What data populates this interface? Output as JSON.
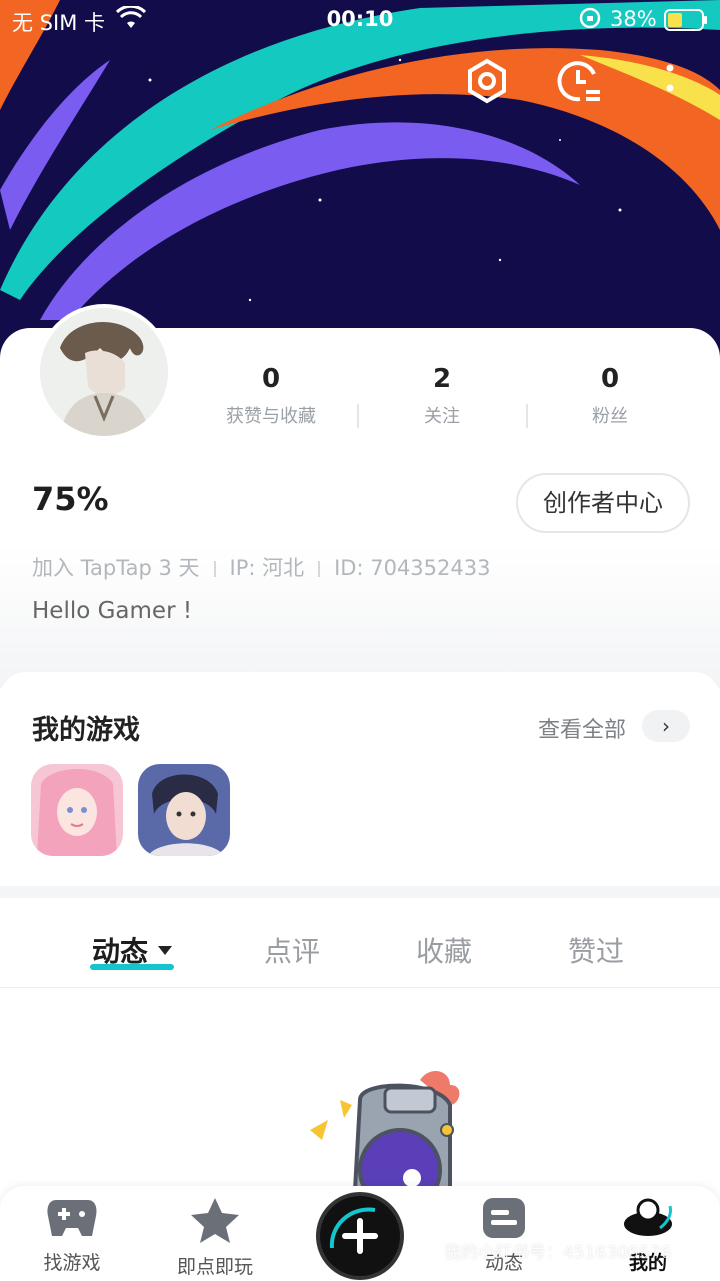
{
  "status_bar": {
    "carrier": "无 SIM 卡",
    "time": "00:10",
    "battery_percent": "38%"
  },
  "header_icons": [
    "settings-hex-icon",
    "history-clock-icon",
    "more-vertical-icon"
  ],
  "profile": {
    "stats": [
      {
        "value": "0",
        "label": "获赞与收藏"
      },
      {
        "value": "2",
        "label": "关注"
      },
      {
        "value": "0",
        "label": "粉丝"
      }
    ],
    "username": "75%",
    "creator_center": "创作者中心",
    "meta": {
      "joined": "加入 TapTap 3 天",
      "ip": "IP: 河北",
      "id": "ID: 704352433"
    },
    "bio": "Hello Gamer !"
  },
  "my_games": {
    "title": "我的游戏",
    "view_all": "查看全部",
    "games": [
      "game-icon-pink-girl",
      "game-icon-dark-boy"
    ]
  },
  "tabs": [
    {
      "label": "动态",
      "active": true
    },
    {
      "label": "点评",
      "active": false
    },
    {
      "label": "收藏",
      "active": false
    },
    {
      "label": "赞过",
      "active": false
    }
  ],
  "bottom_nav": [
    {
      "label": "找游戏",
      "icon": "gamepad-icon"
    },
    {
      "label": "即点即玩",
      "icon": "star-icon"
    },
    {
      "label": "",
      "icon": "plus-icon"
    },
    {
      "label": "动态",
      "icon": "feed-icon"
    },
    {
      "label": "我的",
      "icon": "profile-icon",
      "active": true
    }
  ],
  "watermark": "我的小红书号：4516306576",
  "colors": {
    "accent": "#15c5ce",
    "hero_bg": "#120d4a",
    "stripe_cyan": "#14c9bf",
    "stripe_orange": "#f26522",
    "stripe_purple": "#7b5cf0",
    "stripe_yellow": "#f9e14b"
  }
}
